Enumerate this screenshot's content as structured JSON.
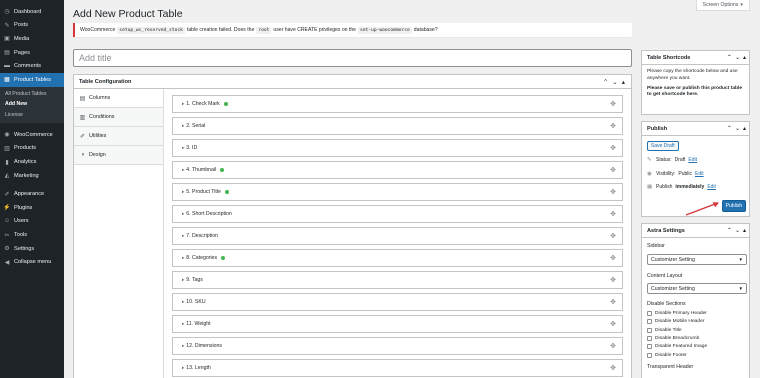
{
  "sidebar": {
    "items": [
      {
        "label": "Dashboard",
        "icon": "dashboard-icon",
        "glyph": "◷"
      },
      {
        "label": "Posts",
        "icon": "pin-icon",
        "glyph": "✎"
      },
      {
        "label": "Media",
        "icon": "media-icon",
        "glyph": "▣"
      },
      {
        "label": "Pages",
        "icon": "pages-icon",
        "glyph": "▤"
      },
      {
        "label": "Comments",
        "icon": "comments-icon",
        "glyph": "▬"
      },
      {
        "label": "Product Tables",
        "icon": "table-icon",
        "glyph": "▦"
      }
    ],
    "submenu": [
      "All Product Tables",
      "Add New",
      "License"
    ],
    "items2": [
      {
        "label": "WooCommerce",
        "icon": "woocommerce-icon",
        "glyph": "◉"
      },
      {
        "label": "Products",
        "icon": "products-icon",
        "glyph": "▥"
      },
      {
        "label": "Analytics",
        "icon": "analytics-icon",
        "glyph": "▮"
      },
      {
        "label": "Marketing",
        "icon": "marketing-icon",
        "glyph": "◭"
      }
    ],
    "items3": [
      {
        "label": "Appearance",
        "icon": "brush-icon",
        "glyph": "✐"
      },
      {
        "label": "Plugins",
        "icon": "plugin-icon",
        "glyph": "⚡"
      },
      {
        "label": "Users",
        "icon": "user-icon",
        "glyph": "☺"
      },
      {
        "label": "Tools",
        "icon": "wrench-icon",
        "glyph": "✂"
      },
      {
        "label": "Settings",
        "icon": "settings-icon",
        "glyph": "⚙"
      },
      {
        "label": "Collapse menu",
        "icon": "collapse-icon",
        "glyph": "◀"
      }
    ]
  },
  "screen_options": {
    "label": "Screen Options",
    "arrow": "▾"
  },
  "page": {
    "title": "Add New Product Table"
  },
  "notice": {
    "part1": "WooCommerce",
    "code1": "setup_wc_reserved_stock",
    "part2": "table creation failed. Does the",
    "code2": "root",
    "part3": "user have CREATE privileges on the",
    "code3": "set-up-woocommerce",
    "part4": "database?"
  },
  "title_input": {
    "placeholder": "Add title",
    "value": ""
  },
  "config": {
    "header": "Table Configuration",
    "tabs": [
      "Columns",
      "Conditions",
      "Utilities",
      "Design"
    ],
    "tab_icons": [
      "▤",
      "▥",
      "✐",
      "◑"
    ],
    "columns": [
      {
        "label": "1. Check Mark",
        "enabled": true
      },
      {
        "label": "2. Serial",
        "enabled": false
      },
      {
        "label": "3. ID",
        "enabled": false
      },
      {
        "label": "4. Thumbnail",
        "enabled": true
      },
      {
        "label": "5. Product Title",
        "enabled": true
      },
      {
        "label": "6. Short Description",
        "enabled": false
      },
      {
        "label": "7. Description",
        "enabled": false
      },
      {
        "label": "8. Categories",
        "enabled": true
      },
      {
        "label": "9. Tags",
        "enabled": false
      },
      {
        "label": "10. SKU",
        "enabled": false
      },
      {
        "label": "11. Weight",
        "enabled": false
      },
      {
        "label": "12. Dimensions",
        "enabled": false
      },
      {
        "label": "13. Length",
        "enabled": false
      }
    ]
  },
  "shortcode": {
    "header": "Table Shortcode",
    "text": "Please copy the shortcode below and use anywhere you want.",
    "notice": "Please save or publish this product table to get shortcode here."
  },
  "publish": {
    "header": "Publish",
    "save_draft": "Save Draft",
    "status_label": "Status:",
    "status_value": "Draft",
    "visibility_label": "Visibility:",
    "visibility_value": "Public",
    "publish_label": "Publish",
    "publish_value": "immediately",
    "edit": "Edit",
    "button": "Publish"
  },
  "astra": {
    "header": "Astra Settings",
    "sidebar_label": "Sidebar",
    "sidebar_value": "Customizer Setting",
    "layout_label": "Content Layout",
    "layout_value": "Customizer Setting",
    "disable_label": "Disable Sections",
    "options": [
      "Disable Primary Header",
      "Disable Mobile Header",
      "Disable Title",
      "Disable Breadcrumb",
      "Disable Featured Image",
      "Disable Footer"
    ],
    "transparent_label": "Transparent Header"
  },
  "colors": {
    "accent": "#2271b1",
    "sidebar_bg": "#1d2327",
    "enabled_dot": "#46b450",
    "error": "#d63638",
    "annotation_arrow": "#d63638"
  }
}
